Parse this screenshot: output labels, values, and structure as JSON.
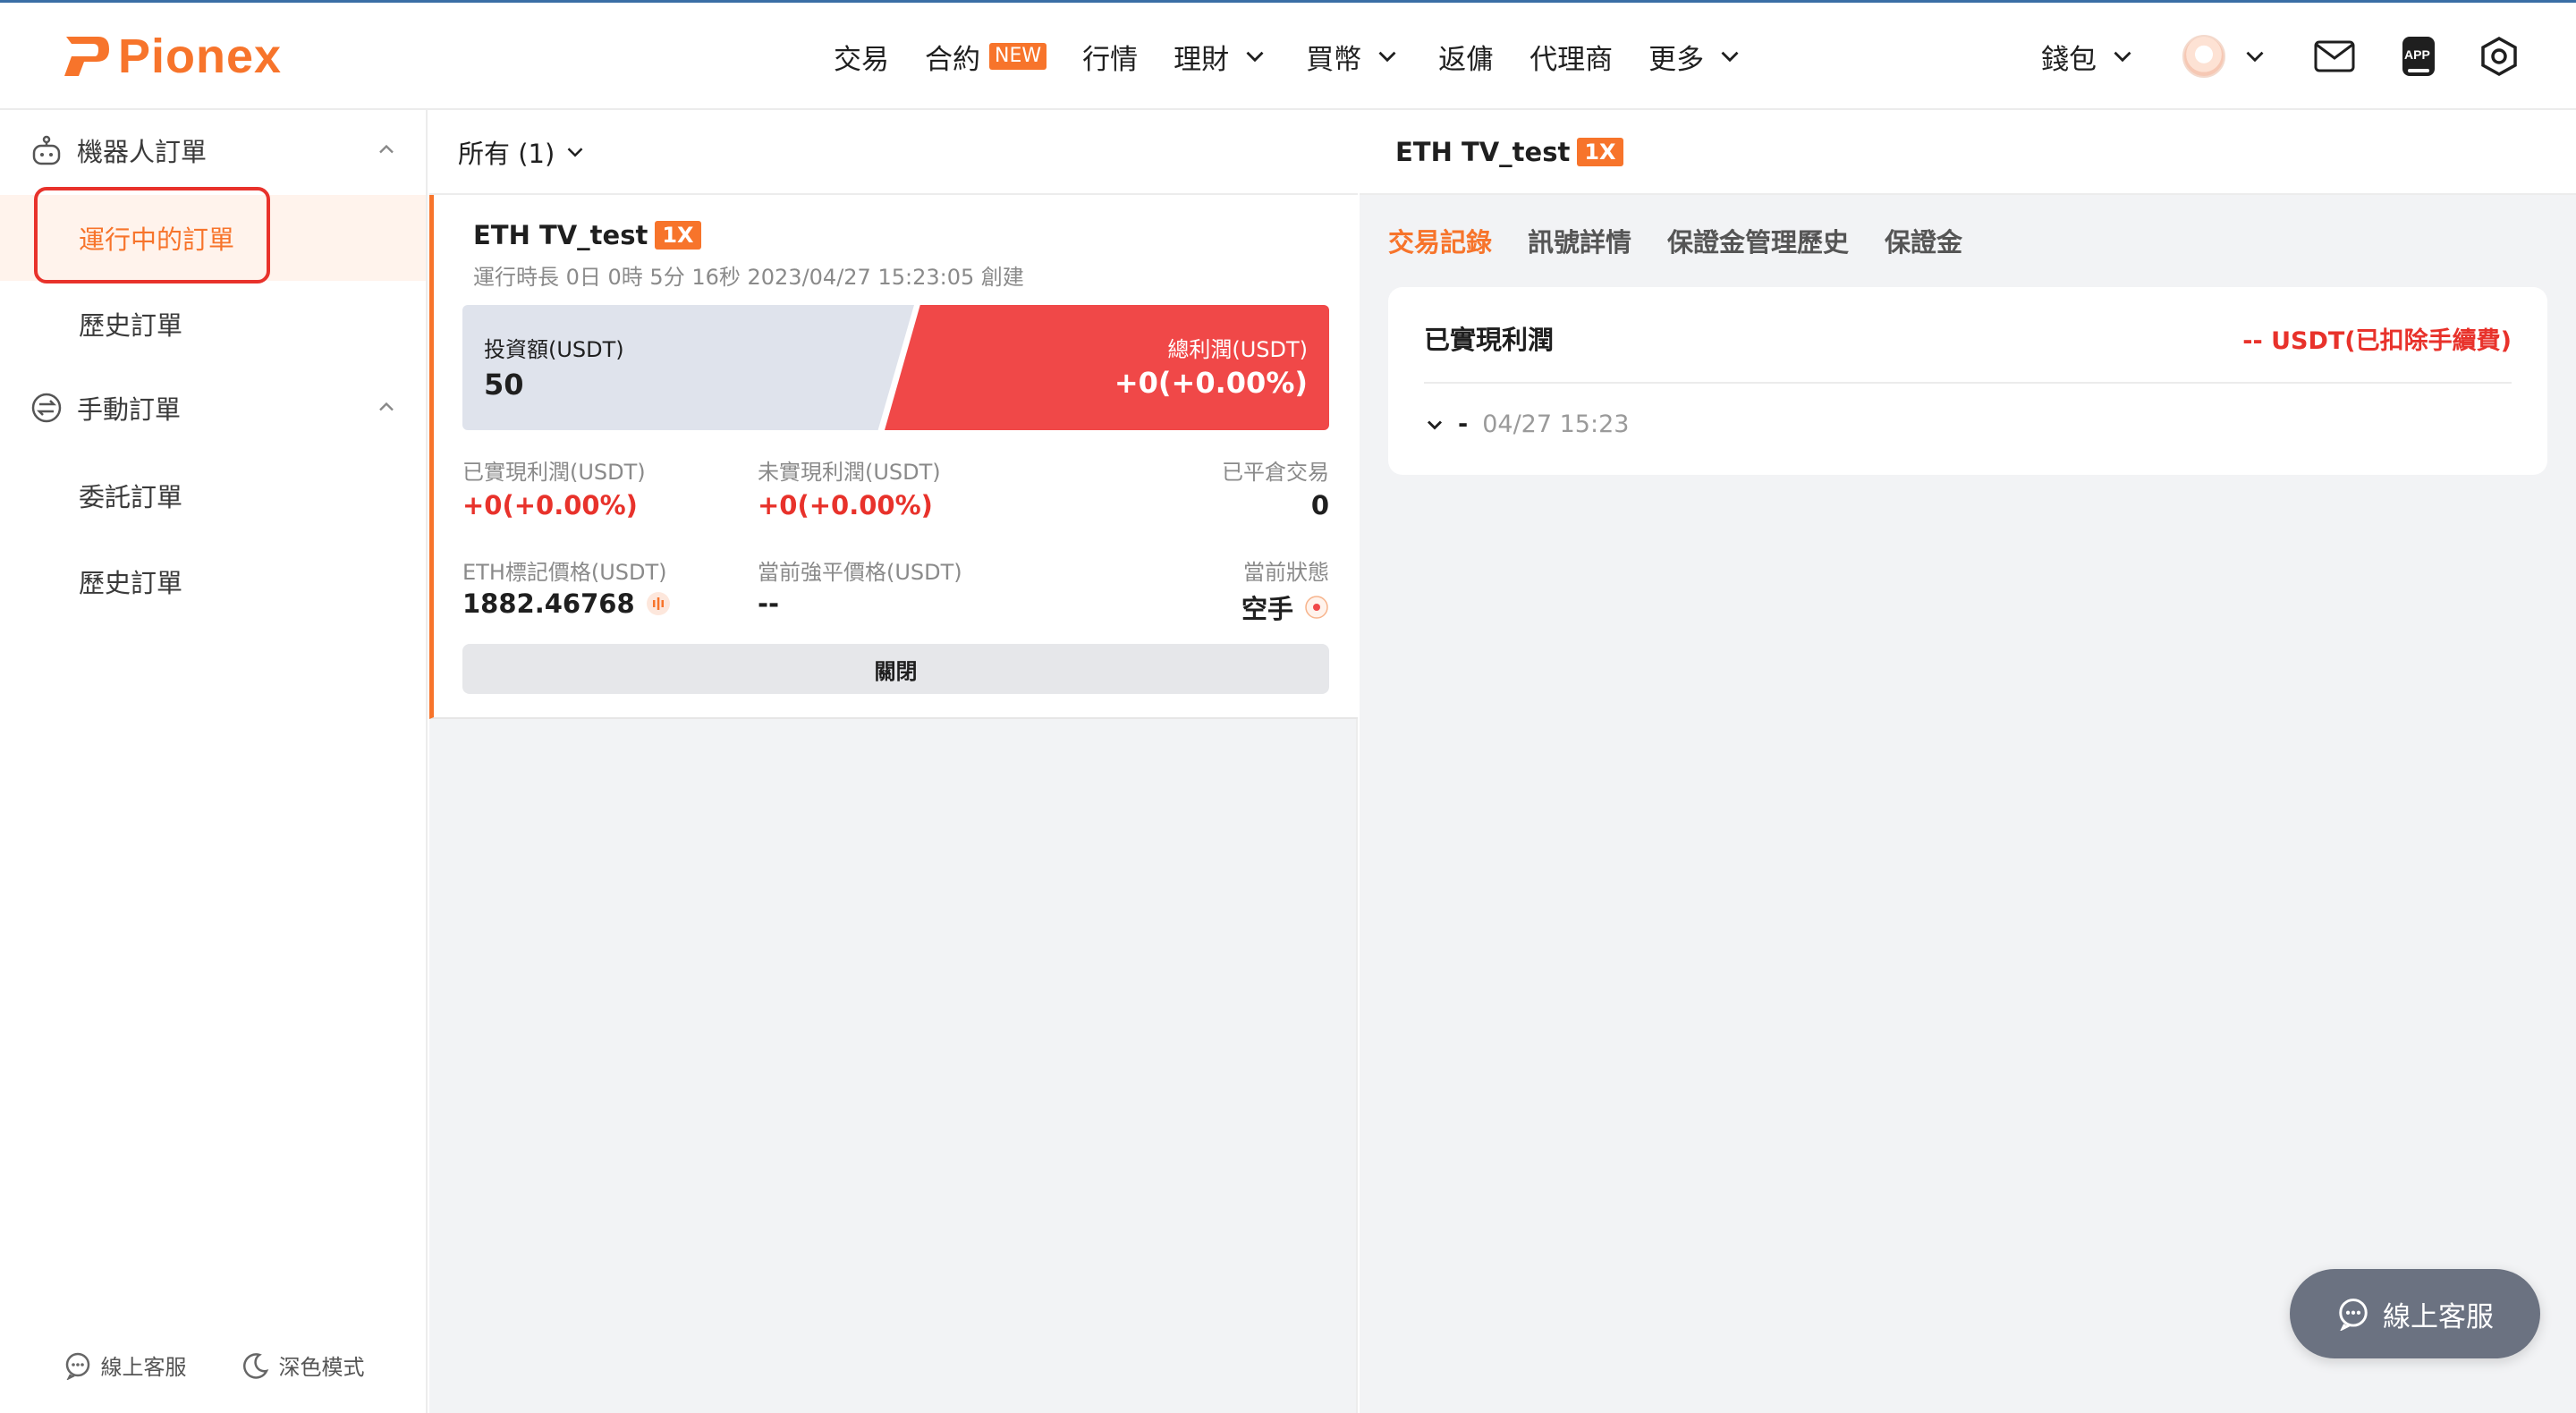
{
  "header": {
    "logo_text": "Pionex",
    "nav": [
      {
        "label": "交易"
      },
      {
        "label": "合約",
        "badge": "NEW"
      },
      {
        "label": "行情"
      },
      {
        "label": "理財"
      },
      {
        "label": "買幣"
      },
      {
        "label": "返傭"
      },
      {
        "label": "代理商"
      },
      {
        "label": "更多"
      }
    ],
    "wallet_label": "錢包",
    "app_badge": "APP"
  },
  "sidebar": {
    "robot_group": "機器人訂單",
    "robot_items": [
      "運行中的訂單",
      "歷史訂單"
    ],
    "manual_group": "手動訂單",
    "manual_items": [
      "委託訂單",
      "歷史訂單"
    ],
    "footer": {
      "support": "線上客服",
      "dark_mode": "深色模式"
    }
  },
  "middle": {
    "filter_label": "所有 (1)",
    "card": {
      "name": "ETH TV_test",
      "leverage": "1X",
      "subtitle": "運行時長 0日 0時 5分 16秒 2023/04/27 15:23:05 創建",
      "invest_label": "投資額(USDT)",
      "invest_value": "50",
      "profit_label": "總利潤(USDT)",
      "profit_value": "+0(+0.00%)",
      "realized_label": "已實現利潤(USDT)",
      "realized_value": "+0(+0.00%)",
      "unrealized_label": "未實現利潤(USDT)",
      "unrealized_value": "+0(+0.00%)",
      "closed_trades_label": "已平倉交易",
      "closed_trades_value": "0",
      "mark_price_label": "ETH標記價格(USDT)",
      "mark_price_value": "1882.46768",
      "liq_price_label": "當前強平價格(USDT)",
      "liq_price_value": "--",
      "status_label": "當前狀態",
      "status_value": "空手",
      "close_button": "關閉"
    }
  },
  "right": {
    "title": "ETH TV_test",
    "leverage": "1X",
    "tabs": [
      "交易記錄",
      "訊號詳情",
      "保證金管理歷史",
      "保證金"
    ],
    "record": {
      "title": "已實現利潤",
      "value": "-- USDT(已扣除手續費)",
      "row_dash": "-",
      "row_time": "04/27 15:23"
    }
  },
  "float_chat": "線上客服",
  "colors": {
    "accent": "#f7742b",
    "profit_red": "#f04848",
    "highlight_red": "#e8322b"
  }
}
